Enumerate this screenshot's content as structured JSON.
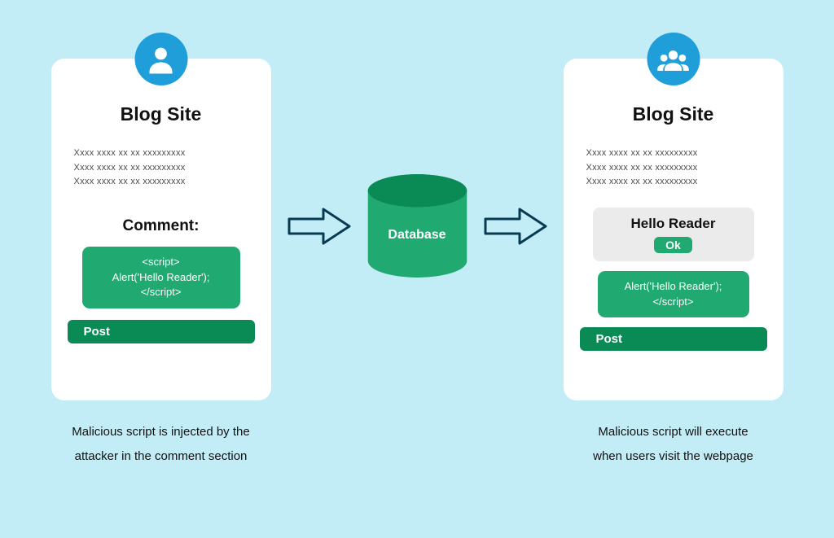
{
  "left_card": {
    "title": "Blog Site",
    "placeholder": "Xxxx xxxx xx xx xxxxxxxxx\nXxxx xxxx xx xx xxxxxxxxx\nXxxx xxxx xx xx xxxxxxxxx",
    "comment_label": "Comment:",
    "script_code": "<script>\nAlert('Hello Reader');\n</script>",
    "post_label": "Post"
  },
  "left_caption": "Malicious script is injected by the\nattacker in the comment section",
  "database_label": "Database",
  "right_card": {
    "title": "Blog Site",
    "placeholder": "Xxxx xxxx xx xx xxxxxxxxx\nXxxx xxxx xx xx xxxxxxxxx\nXxxx xxxx xx xx xxxxxxxxx",
    "alert_title": "Hello Reader",
    "ok_label": "Ok",
    "script_code": "Alert('Hello Reader');\n</script>",
    "post_label": "Post"
  },
  "right_caption": "Malicious script will execute\nwhen users visit the webpage"
}
